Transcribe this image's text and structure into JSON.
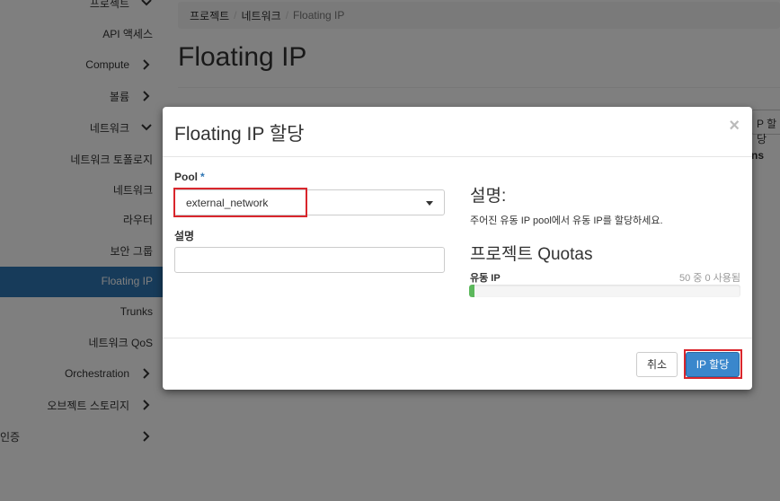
{
  "sidebar": {
    "items": [
      {
        "label": "프로젝트",
        "chevron": "chevron-down"
      },
      {
        "label": "API 액세스",
        "chevron": ""
      },
      {
        "label": "Compute",
        "chevron": "chevron-right"
      },
      {
        "label": "볼륨",
        "chevron": "chevron-right"
      },
      {
        "label": "네트워크",
        "chevron": "chevron-down"
      },
      {
        "label": "네트워크 토폴로지",
        "chevron": ""
      },
      {
        "label": "네트워크",
        "chevron": ""
      },
      {
        "label": "라우터",
        "chevron": ""
      },
      {
        "label": "보안 그룹",
        "chevron": ""
      },
      {
        "label": "Floating IP",
        "chevron": "",
        "active": true
      },
      {
        "label": "Trunks",
        "chevron": ""
      },
      {
        "label": "네트워크 QoS",
        "chevron": ""
      },
      {
        "label": "Orchestration",
        "chevron": "chevron-right"
      },
      {
        "label": "오브젝트 스토리지",
        "chevron": "chevron-right"
      },
      {
        "label": "인증",
        "chevron": "chevron-right"
      }
    ]
  },
  "breadcrumb": {
    "items": [
      "프로젝트",
      "네트워크",
      "Floating IP"
    ]
  },
  "page": {
    "title": "Floating IP",
    "bg_button_label": "P 할당",
    "bg_column_label": "ns"
  },
  "modal": {
    "title": "Floating IP 할당",
    "close_glyph": "×",
    "pool_label": "Pool",
    "required_mark": "*",
    "pool_value": "external_network",
    "description_label": "설명",
    "description_value": "",
    "help_heading": "설명:",
    "help_text": "주어진 유동 IP pool에서 유동 IP를 할당하세요.",
    "quota_heading": "프로젝트 Quotas",
    "quota_label": "유동 IP",
    "quota_count": "50 중 0 사용됨",
    "quota_used": 0,
    "quota_total": 50,
    "quota_fill_fraction": 0.02,
    "cancel_label": "취소",
    "submit_label": "IP 할당"
  },
  "colors": {
    "accent": "#2e76b4",
    "highlight": "#d9262c",
    "progress": "#5cb85c"
  }
}
